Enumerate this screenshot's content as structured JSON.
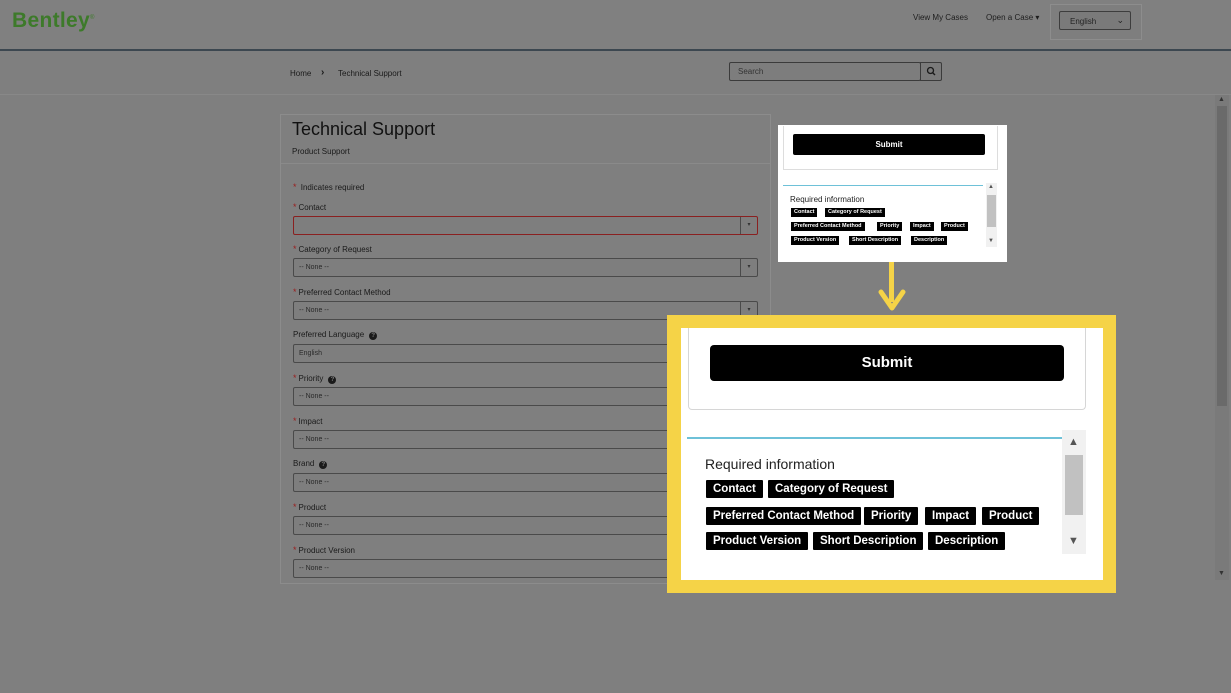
{
  "header": {
    "logo": "Bentley",
    "links": [
      "View My Cases",
      "Open a Case"
    ],
    "language": "English"
  },
  "breadcrumb": {
    "home": "Home",
    "current": "Technical Support"
  },
  "search": {
    "placeholder": "Search"
  },
  "form": {
    "title": "Technical Support",
    "subtitle": "Product Support",
    "required_note": "Indicates required",
    "fields": [
      {
        "label": "Contact",
        "value": ""
      },
      {
        "label": "Category of Request",
        "value": "-- None --"
      },
      {
        "label": "Preferred Contact Method",
        "value": "-- None --"
      },
      {
        "label": "Preferred Language",
        "value": "English"
      },
      {
        "label": "Priority",
        "value": "-- None --"
      },
      {
        "label": "Impact",
        "value": "-- None --"
      },
      {
        "label": "Brand",
        "value": "-- None --"
      },
      {
        "label": "Product",
        "value": "-- None --"
      },
      {
        "label": "Product Version",
        "value": "-- None --"
      }
    ],
    "required_marker": "*",
    "help_marker": "?"
  },
  "sidebar": {
    "submit_label": "Submit",
    "required_title": "Required information",
    "required_tags": [
      "Contact",
      "Category of Request",
      "Preferred Contact Method",
      "Priority",
      "Impact",
      "Product",
      "Product Version",
      "Short Description",
      "Description"
    ]
  },
  "colors": {
    "highlight": "#f5d347",
    "accent_rule": "#6ec1d8",
    "logo": "#3d7a2a"
  }
}
